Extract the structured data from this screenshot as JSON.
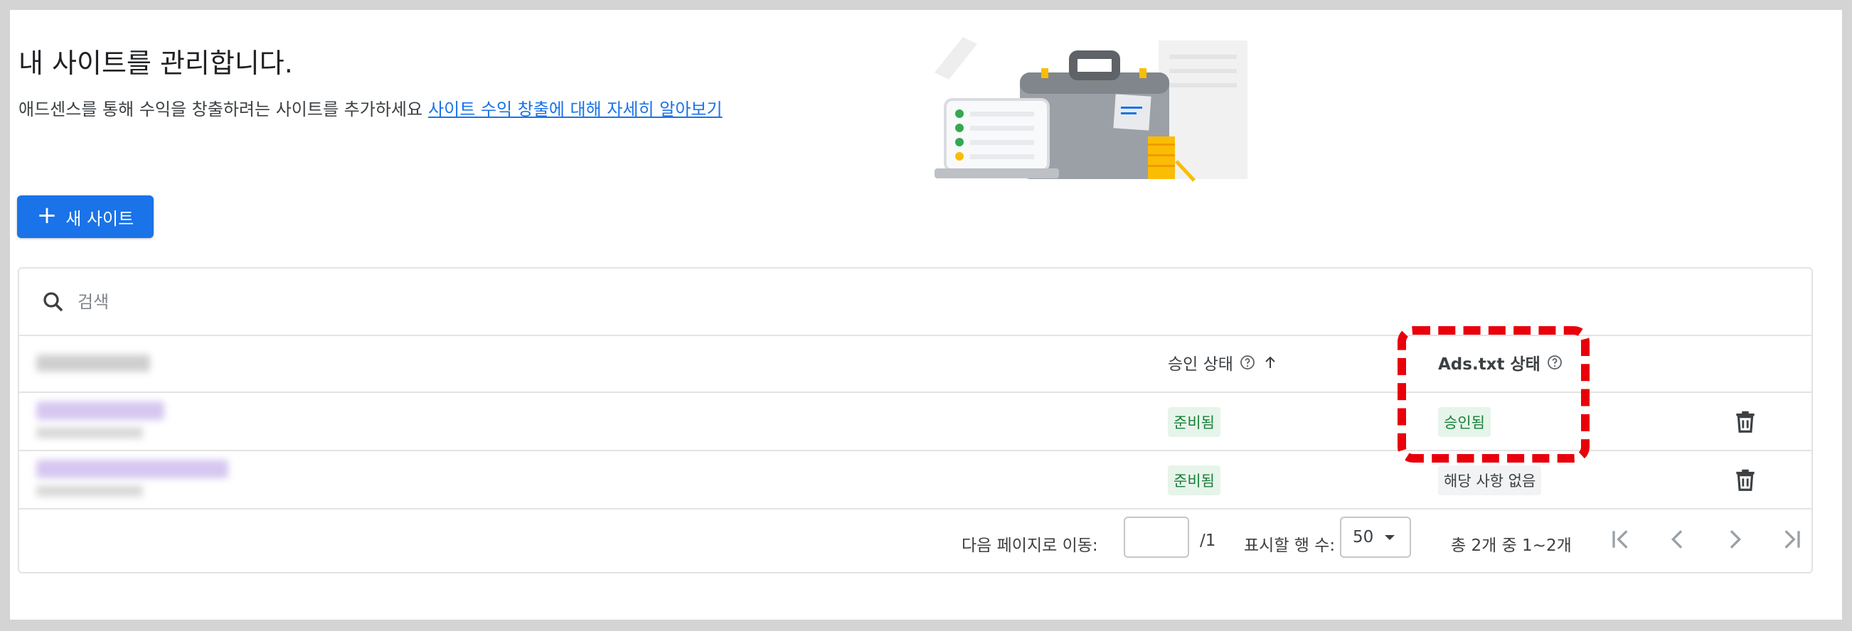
{
  "header": {
    "title": "내 사이트를 관리합니다.",
    "subtitle": "애드센스를 통해 수익을 창출하려는 사이트를 추가하세요",
    "learn_more_link": "사이트 수익 창출에 대해 자세히 알아보기"
  },
  "new_site_button": {
    "label": "새 사이트",
    "icon": "plus-icon"
  },
  "search": {
    "placeholder": "검색",
    "icon": "search-icon"
  },
  "table": {
    "columns": {
      "site": "",
      "approval_status": "승인 상태",
      "ads_txt_status": "Ads.txt 상태"
    },
    "sort": {
      "column": "approval_status",
      "direction": "ascending"
    },
    "rows": [
      {
        "approval_status": "준비됨",
        "ads_txt_status": "승인됨"
      },
      {
        "approval_status": "준비됨",
        "ads_txt_status": "해당 사항 없음"
      }
    ]
  },
  "pagination": {
    "go_to_page_label": "다음 페이지로 이동:",
    "page_input_value": "",
    "total_pages": "/1",
    "rows_per_page_label": "표시할 행 수:",
    "rows_per_page_value": "50",
    "range_text": "총 2개 중 1~2개"
  },
  "colors": {
    "primary": "#1a73e8",
    "status_green_bg": "#e6f4ea",
    "status_green_text": "#188038",
    "highlight_red": "#e8000a"
  }
}
